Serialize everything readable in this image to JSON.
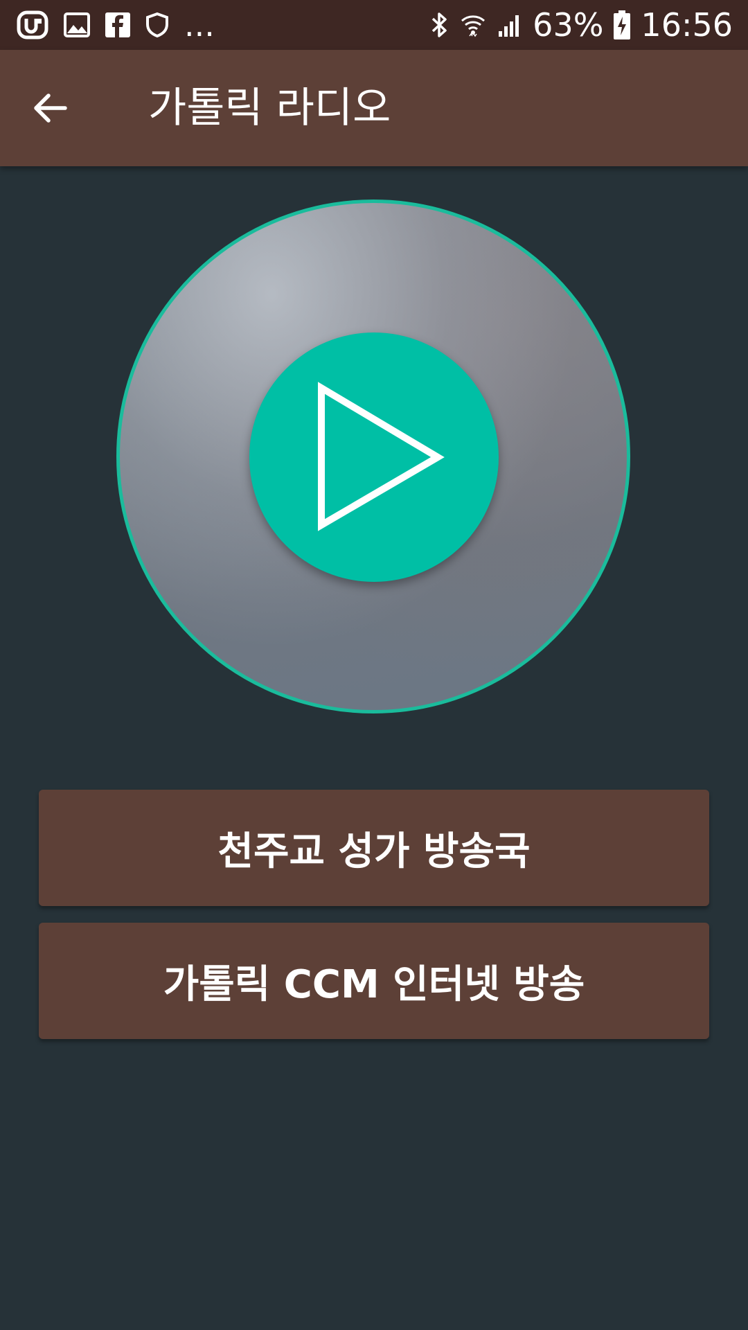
{
  "status_bar": {
    "icons_left": [
      "u-plus-icon",
      "image-icon",
      "facebook-icon",
      "shield-icon",
      "more-icon"
    ],
    "more_text": "...",
    "icons_right": [
      "bluetooth-icon",
      "wifi-icon",
      "signal-icon",
      "battery-icon"
    ],
    "battery": "63%",
    "time": "16:56"
  },
  "app_bar": {
    "back_icon": "arrow-left-icon",
    "title": "가톨릭 라디오"
  },
  "player": {
    "play_icon": "play-icon"
  },
  "stations": [
    {
      "label": "천주교 성가 방송국"
    },
    {
      "label": "가톨릭 CCM 인터넷 방송"
    }
  ],
  "colors": {
    "status_bar": "#3e2723",
    "app_bar": "#5d4037",
    "background": "#263238",
    "accent": "#00bfa5",
    "button": "#5d4037"
  }
}
